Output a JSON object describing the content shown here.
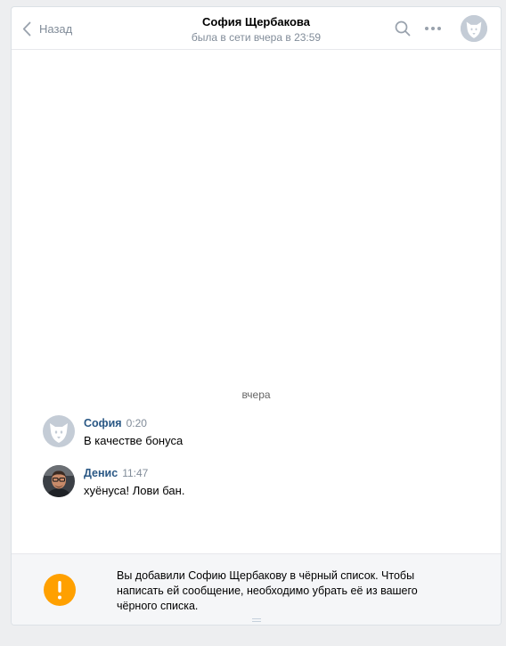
{
  "header": {
    "back_label": "Назад",
    "title": "София Щербакова",
    "subtitle": "была в сети вчера в 23:59"
  },
  "date_separator": "вчера",
  "messages": [
    {
      "author": "София",
      "time": "0:20",
      "text": "В качестве бонуса",
      "avatar": "default-dog-avatar"
    },
    {
      "author": "Денис",
      "time": "11:47",
      "text": "хуёнуса! Лови бан.",
      "avatar": "user-photo"
    }
  ],
  "blacklist_notice": {
    "text": "Вы добавили Софию Щербакову в чёрный список. Чтобы написать ей сообщение, необходимо убрать её из вашего чёрного списка.",
    "icon": "exclamation-icon"
  },
  "colors": {
    "link": "#2a5885",
    "muted": "#818c99",
    "warning": "#ffa000",
    "background": "#edeef0"
  }
}
